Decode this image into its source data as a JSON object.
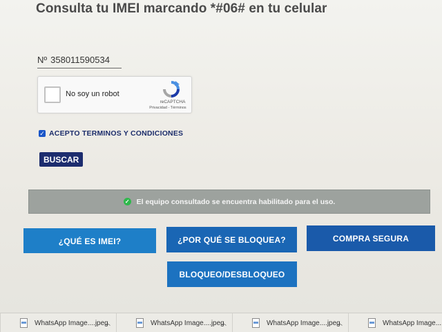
{
  "heading": "Consulta tu IMEI marcando *#06# en tu celular",
  "imei": {
    "prefix": "Nº",
    "value": "358011590534"
  },
  "captcha": {
    "label": "No soy un robot",
    "brand": "reCAPTCHA",
    "links": "Privacidad - Términos"
  },
  "terms": {
    "checked": true,
    "label": "ACEPTO TERMINOS Y CONDICIONES"
  },
  "search_button": "BUSCAR",
  "status": {
    "icon": "check-circle-icon",
    "color": "#2eb84b",
    "text": "El equipo consultado se encuentra habilitado para el uso."
  },
  "nav": {
    "que_es_imei": "¿QUÉ ES IMEI?",
    "por_que_bloquea": "¿POR QUÉ SE BLOQUEA?",
    "compra_segura": "COMPRA SEGURA",
    "bloqueo_desbloqueo": "BLOQUEO/DESBLOQUEO"
  },
  "downloads": [
    {
      "name": "WhatsApp Image....jpeg"
    },
    {
      "name": "WhatsApp Image....jpeg"
    },
    {
      "name": "WhatsApp Image....jpeg"
    },
    {
      "name": "WhatsApp Image....jpe"
    }
  ],
  "colors": {
    "brand_dark": "#1c2c6e",
    "brand_blue": "#1e7fc8",
    "status_bg": "#9da29e"
  }
}
